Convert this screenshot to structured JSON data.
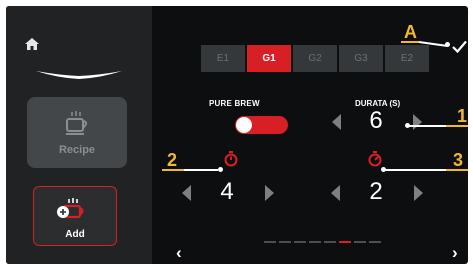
{
  "sidebar": {
    "home_icon": "home-icon",
    "logo_icon": "brand-mustache-logo",
    "recipe_label": "Recipe",
    "add_label": "Add"
  },
  "tabs": [
    {
      "label": "E1",
      "active": false
    },
    {
      "label": "G1",
      "active": true
    },
    {
      "label": "G2",
      "active": false
    },
    {
      "label": "G3",
      "active": false
    },
    {
      "label": "E2",
      "active": false
    }
  ],
  "confirm_icon": "checkmark-icon",
  "pure_brew": {
    "label": "PURE BREW",
    "enabled": true
  },
  "durata": {
    "label": "DURATA (S)",
    "value": "6"
  },
  "timer_left": {
    "value": "4"
  },
  "timer_right": {
    "value": "2"
  },
  "callouts": {
    "a": "A",
    "one": "1",
    "two": "2",
    "three": "3"
  },
  "pager": {
    "pages": 8,
    "active_index": 5
  },
  "nav": {
    "prev": "‹",
    "next": "›"
  },
  "colors": {
    "accent": "#d81f26",
    "callout": "#f3b92d",
    "background": "#0d0e0f",
    "sidebar": "#202224"
  }
}
